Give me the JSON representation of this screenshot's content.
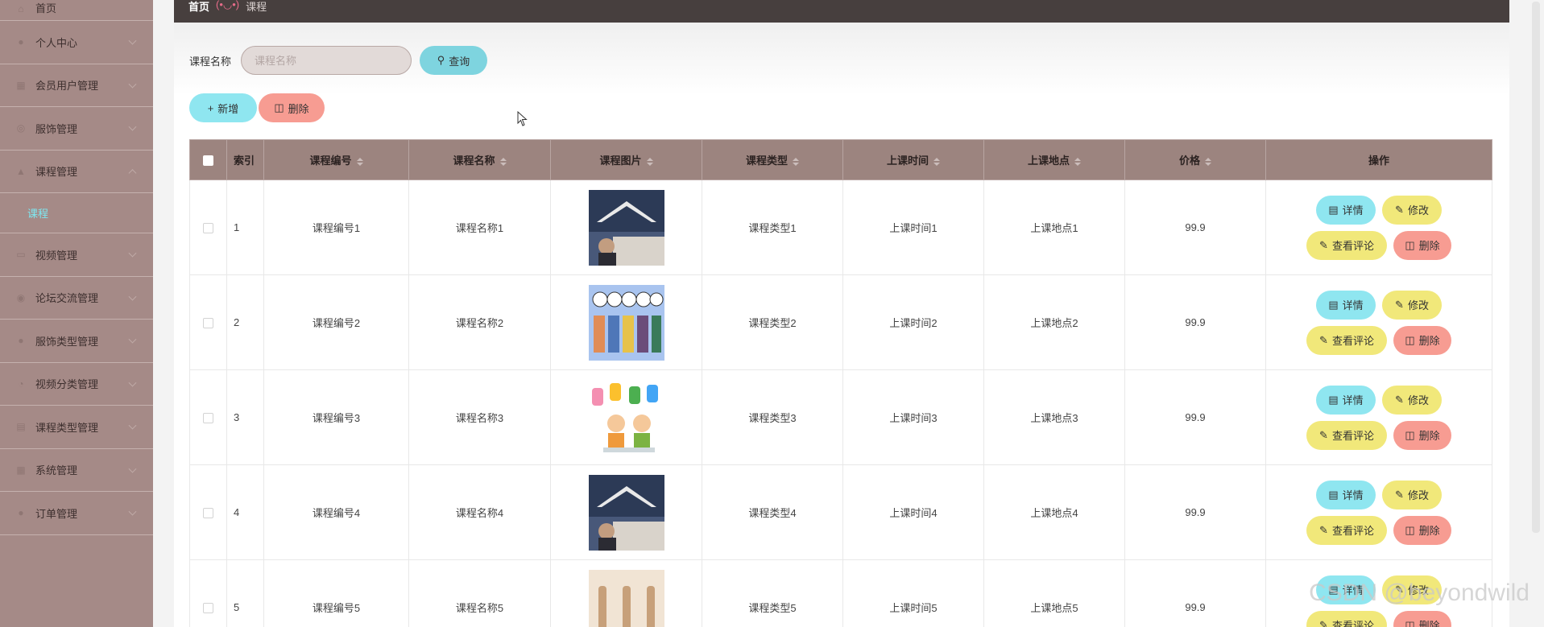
{
  "sidebar": {
    "items": [
      {
        "label": "首页",
        "icon": "home-icon",
        "glyph": "⌂"
      },
      {
        "label": "个人中心",
        "icon": "user-icon",
        "glyph": "●"
      },
      {
        "label": "会员用户管理",
        "icon": "users-icon",
        "glyph": "▦"
      },
      {
        "label": "服饰管理",
        "icon": "clothing-icon",
        "glyph": "◎"
      },
      {
        "label": "课程管理",
        "icon": "course-icon",
        "glyph": "▲",
        "expanded": true
      },
      {
        "label": "视频管理",
        "icon": "video-icon",
        "glyph": "▭"
      },
      {
        "label": "论坛交流管理",
        "icon": "forum-icon",
        "glyph": "◉"
      },
      {
        "label": "服饰类型管理",
        "icon": "clothing-type-icon",
        "glyph": "●"
      },
      {
        "label": "视频分类管理",
        "icon": "video-category-icon",
        "glyph": "◔"
      },
      {
        "label": "课程类型管理",
        "icon": "course-type-icon",
        "glyph": "▤"
      },
      {
        "label": "系统管理",
        "icon": "system-icon",
        "glyph": "▦"
      },
      {
        "label": "订单管理",
        "icon": "order-icon",
        "glyph": "●"
      }
    ],
    "sub_item": "课程"
  },
  "breadcrumb": {
    "home": "首页",
    "separator": "(•◡•)",
    "current": "课程"
  },
  "search": {
    "label": "课程名称",
    "placeholder": "课程名称",
    "button": "查询"
  },
  "actions": {
    "add": "新增",
    "delete": "删除"
  },
  "table": {
    "headers": [
      "索引",
      "课程编号",
      "课程名称",
      "课程图片",
      "课程类型",
      "上课时间",
      "上课地点",
      "价格",
      "操作"
    ],
    "rows": [
      {
        "index": "1",
        "code": "课程编号1",
        "name": "课程名称1",
        "type": "课程类型1",
        "time": "上课时间1",
        "place": "上课地点1",
        "price": "99.9",
        "image": "classroom"
      },
      {
        "index": "2",
        "code": "课程编号2",
        "name": "课程名称2",
        "type": "课程类型2",
        "time": "上课时间2",
        "place": "上课地点2",
        "price": "99.9",
        "image": "hello"
      },
      {
        "index": "3",
        "code": "课程编号3",
        "name": "课程名称3",
        "type": "课程类型3",
        "time": "上课时间3",
        "place": "上课地点3",
        "price": "99.9",
        "image": "abcd"
      },
      {
        "index": "4",
        "code": "课程编号4",
        "name": "课程名称4",
        "type": "课程类型4",
        "time": "上课时间4",
        "place": "上课地点4",
        "price": "99.9",
        "image": "classroom"
      },
      {
        "index": "5",
        "code": "课程编号5",
        "name": "课程名称5",
        "type": "课程类型5",
        "time": "上课时间5",
        "place": "上课地点5",
        "price": "99.9",
        "image": "yoga"
      }
    ],
    "op_labels": {
      "detail": "详情",
      "edit": "修改",
      "review": "查看评论",
      "remove": "删除"
    }
  },
  "watermark": "CSDN @beyondwild",
  "colors": {
    "sidebar": "#a58a87",
    "topbar": "#473f3e",
    "header": "#9c847f",
    "cyan": "#8fe6f0",
    "yellow": "#f1e87a",
    "red": "#f79c92",
    "active": "#7ee7f0"
  }
}
